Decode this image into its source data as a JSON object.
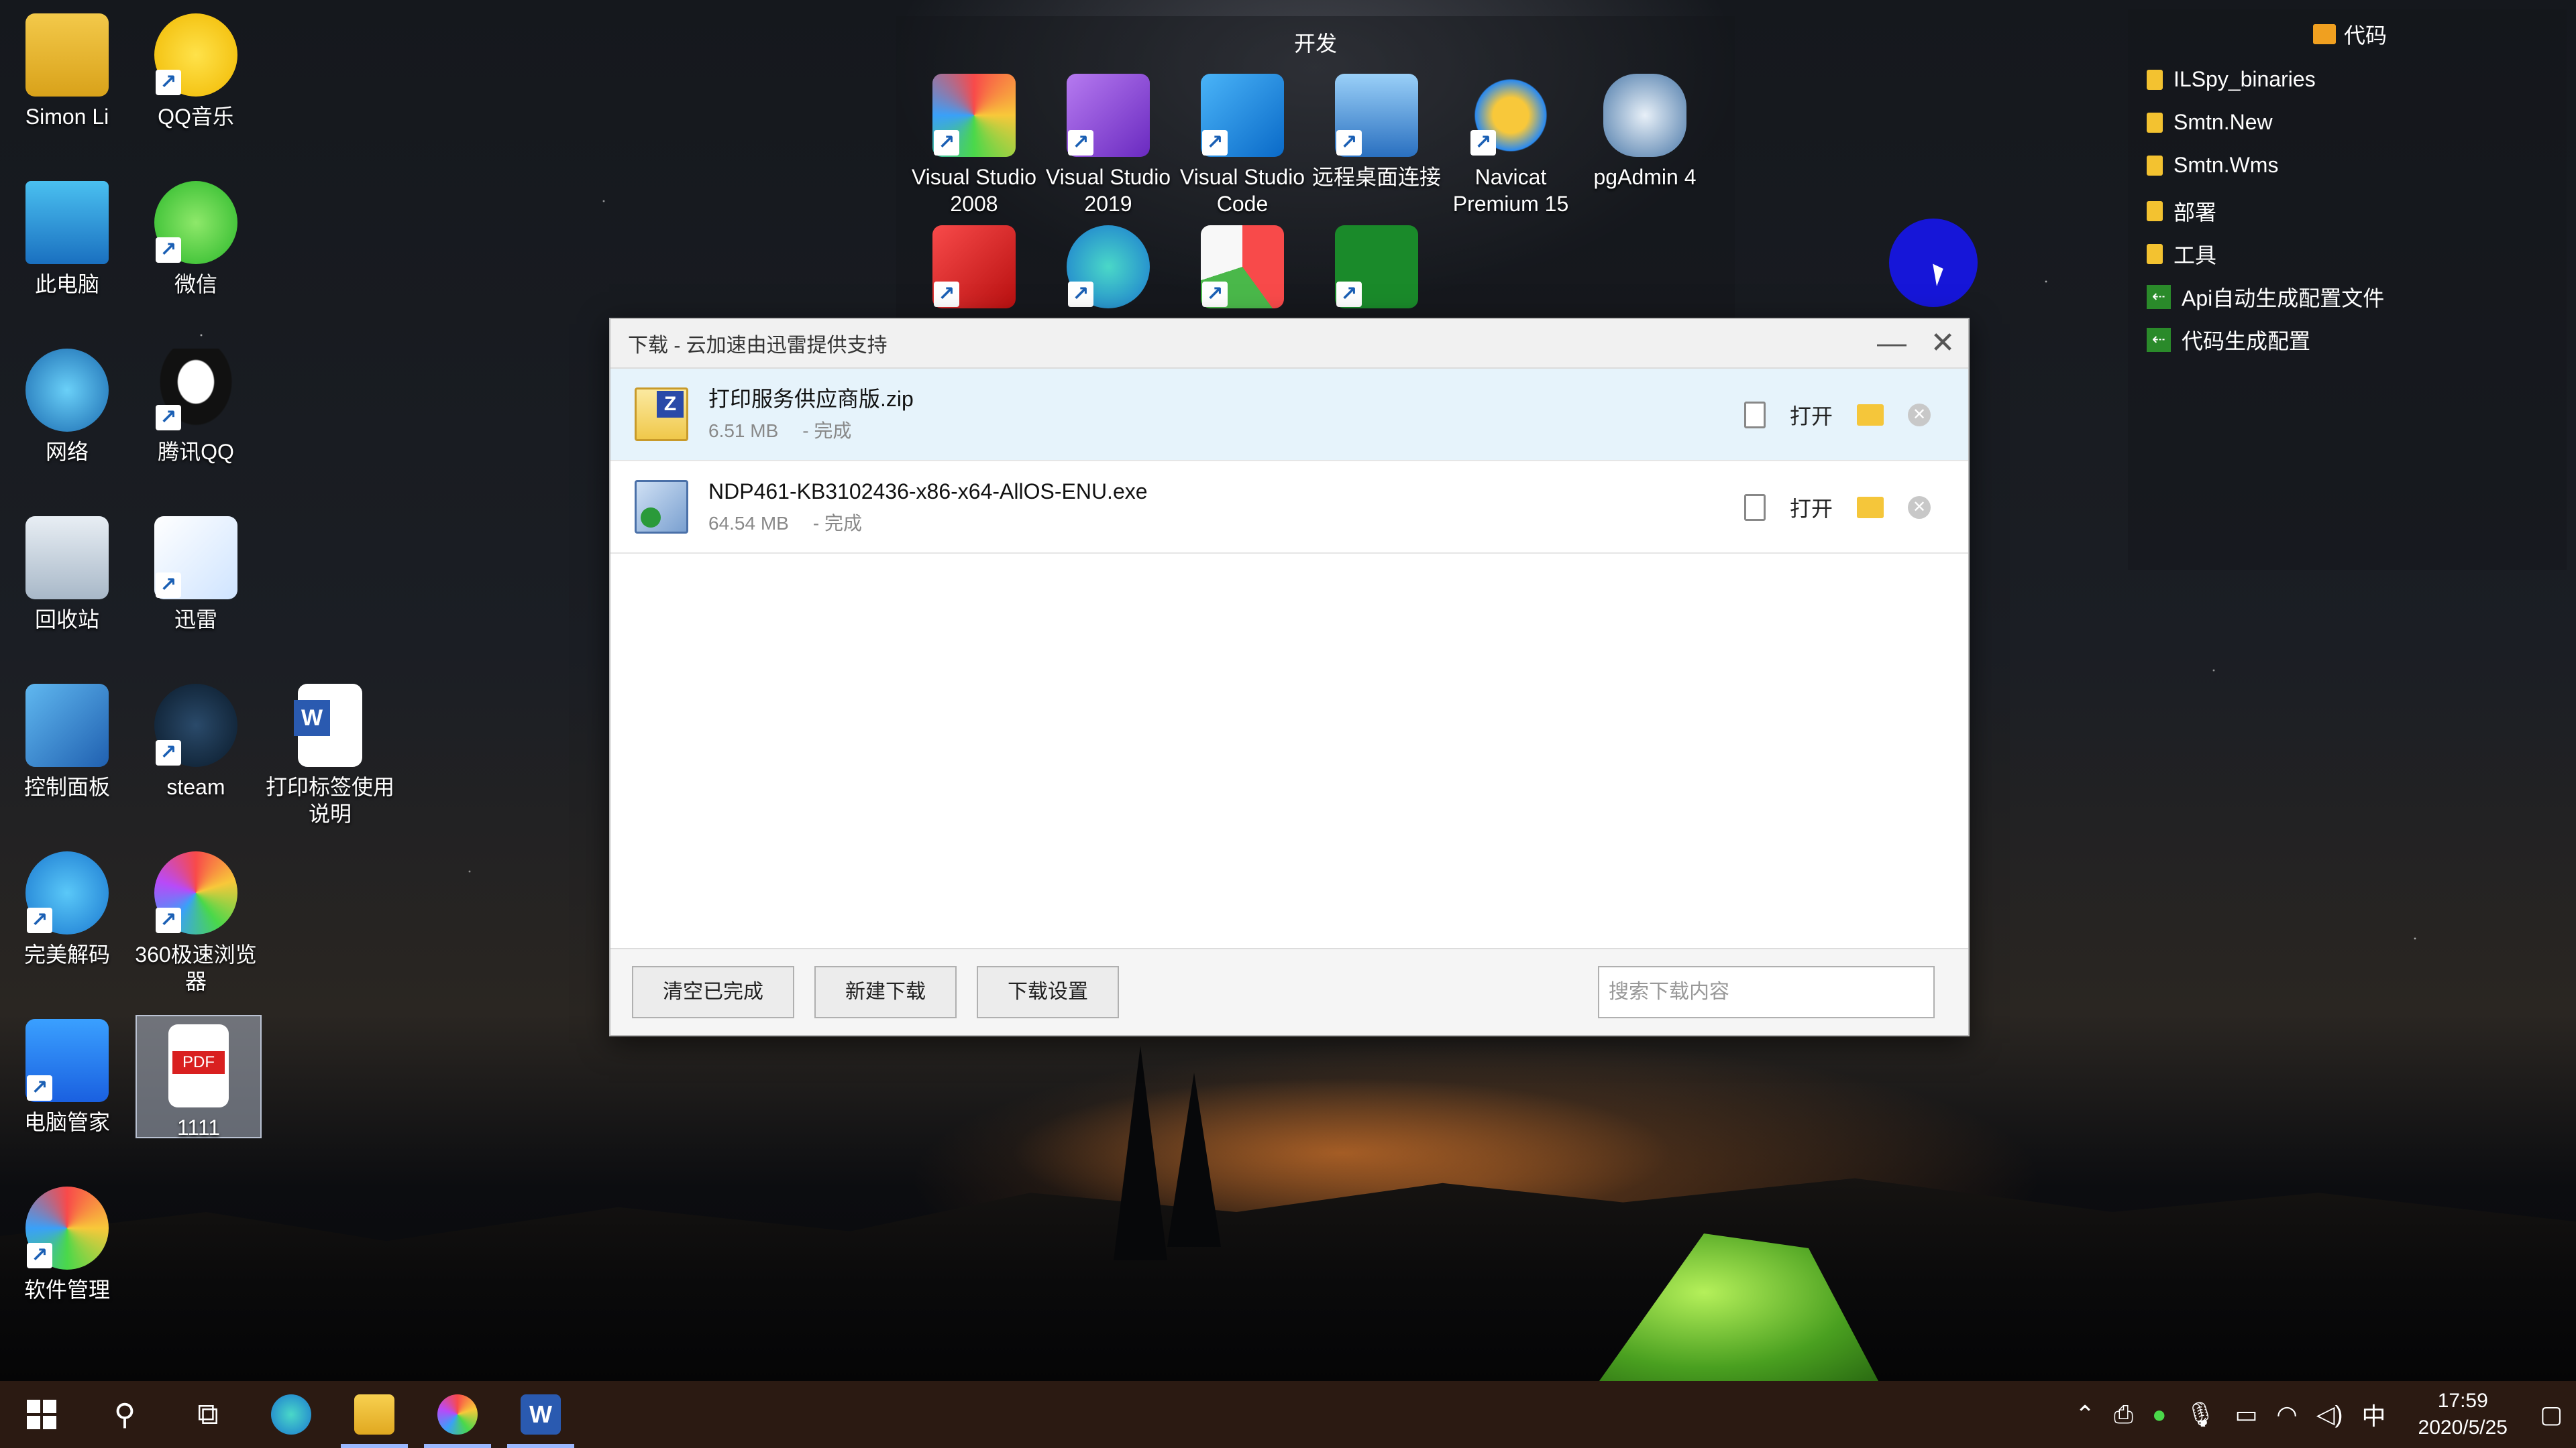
{
  "desktop": {
    "left_col": [
      {
        "label": "Simon Li",
        "icon": "user-folder-icon"
      },
      {
        "label": "此电脑",
        "icon": "computer-icon"
      },
      {
        "label": "网络",
        "icon": "network-icon"
      },
      {
        "label": "回收站",
        "icon": "recycle-bin-icon"
      },
      {
        "label": "控制面板",
        "icon": "control-panel-icon"
      },
      {
        "label": "完美解码",
        "icon": "player-icon"
      },
      {
        "label": "电脑管家",
        "icon": "pc-manager-icon"
      },
      {
        "label": "软件管理",
        "icon": "software-manager-icon"
      }
    ],
    "second_col": [
      {
        "label": "QQ音乐",
        "icon": "qq-music-icon"
      },
      {
        "label": "微信",
        "icon": "wechat-icon"
      },
      {
        "label": "腾讯QQ",
        "icon": "qq-icon"
      },
      {
        "label": "迅雷",
        "icon": "thunder-icon"
      },
      {
        "label": "steam",
        "icon": "steam-icon"
      },
      {
        "label": "360极速浏览器",
        "icon": "360-browser-icon"
      },
      {
        "label": "1111",
        "icon": "pdf-file-icon"
      }
    ],
    "third_col": [
      {
        "label": "打印标签使用说明",
        "icon": "word-doc-icon"
      }
    ]
  },
  "dev_fence": {
    "title": "开发",
    "items": [
      {
        "label": "Visual Studio 2008"
      },
      {
        "label": "Visual Studio 2019"
      },
      {
        "label": "Visual Studio Code"
      },
      {
        "label": "远程桌面连接"
      },
      {
        "label": "Navicat Premium 15"
      },
      {
        "label": "pgAdmin 4"
      }
    ]
  },
  "code_fence": {
    "title": "代码",
    "items": [
      {
        "label": "ILSpy_binaries",
        "type": "folder"
      },
      {
        "label": "Smtn.New",
        "type": "folder"
      },
      {
        "label": "Smtn.Wms",
        "type": "folder"
      },
      {
        "label": "部署",
        "type": "folder"
      },
      {
        "label": "工具",
        "type": "folder"
      },
      {
        "label": "Api自动生成配置文件",
        "type": "shortcut"
      },
      {
        "label": "代码生成配置",
        "type": "shortcut"
      }
    ]
  },
  "download_window": {
    "title": "下载 - 云加速由迅雷提供支持",
    "minimize_glyph": "—",
    "close_glyph": "✕",
    "items": [
      {
        "name": "打印服务供应商版.zip",
        "size": "6.51 MB",
        "status": "- 完成",
        "open_label": "打开",
        "type": "zip"
      },
      {
        "name": "NDP461-KB3102436-x86-x64-AllOS-ENU.exe",
        "size": "64.54 MB",
        "status": "- 完成",
        "open_label": "打开",
        "type": "exe"
      }
    ],
    "footer": {
      "clear_label": "清空已完成",
      "new_label": "新建下载",
      "settings_label": "下载设置",
      "search_placeholder": "搜索下载内容"
    }
  },
  "taskbar": {
    "apps": [
      "start",
      "search",
      "task-view",
      "edge",
      "file-explorer",
      "360-browser",
      "word"
    ],
    "tray": {
      "ime": "中",
      "time": "17:59",
      "date": "2020/5/25"
    }
  },
  "colors": {
    "taskbar": "#2b1a12",
    "selected_row": "#e6f3fb",
    "cursor_highlight": "#1616d8"
  }
}
